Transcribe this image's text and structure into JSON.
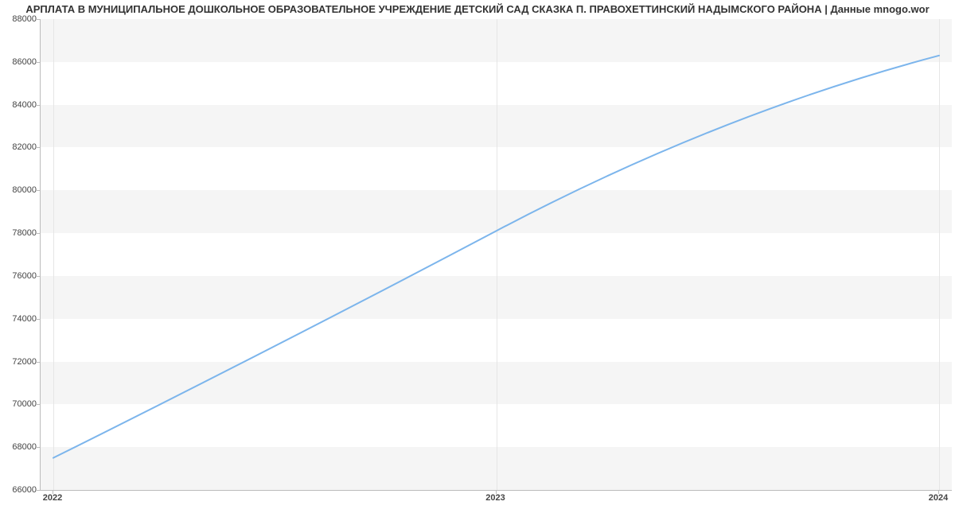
{
  "chart_data": {
    "type": "line",
    "title": "АРПЛАТА В МУНИЦИПАЛЬНОЕ ДОШКОЛЬНОЕ ОБРАЗОВАТЕЛЬНОЕ УЧРЕЖДЕНИЕ ДЕТСКИЙ САД СКАЗКА П. ПРАВОХЕТТИНСКИЙ НАДЫМСКОГО РАЙОНА | Данные mnogo.wor",
    "xlabel": "",
    "ylabel": "",
    "x": [
      "2022",
      "2023",
      "2024"
    ],
    "y": [
      67500,
      78100,
      86300
    ],
    "x_ticks": [
      "2022",
      "2023",
      "2024"
    ],
    "y_ticks": [
      66000,
      68000,
      70000,
      72000,
      74000,
      76000,
      78000,
      80000,
      82000,
      84000,
      86000,
      88000
    ],
    "ylim": [
      66000,
      88000
    ],
    "grid": true
  },
  "yticks": {
    "t0": "66000",
    "t1": "68000",
    "t2": "70000",
    "t3": "72000",
    "t4": "74000",
    "t5": "76000",
    "t6": "78000",
    "t7": "80000",
    "t8": "82000",
    "t9": "84000",
    "t10": "86000",
    "t11": "88000"
  },
  "xticks": {
    "x0": "2022",
    "x1": "2023",
    "x2": "2024"
  }
}
